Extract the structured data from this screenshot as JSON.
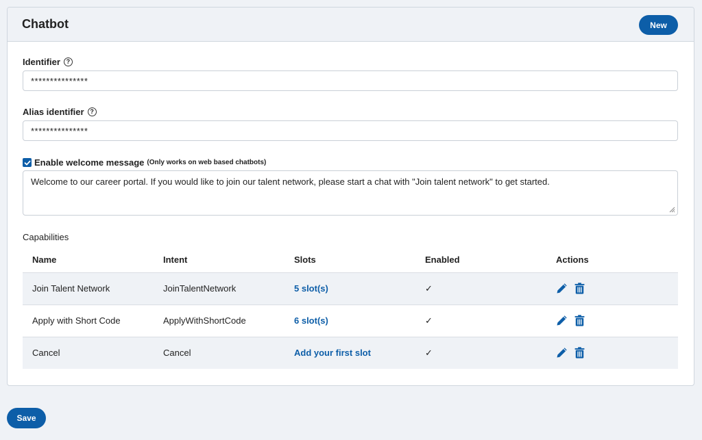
{
  "header": {
    "title": "Chatbot",
    "new_label": "New"
  },
  "identifier": {
    "label": "Identifier",
    "value": "***************"
  },
  "alias": {
    "label": "Alias identifier",
    "value": "***************"
  },
  "welcome": {
    "enabled": true,
    "label": "Enable welcome message",
    "note": "(Only works on web based chatbots)",
    "message": "Welcome to our career portal. If you would like to join our talent network, please start a chat with \"Join talent network\" to get started."
  },
  "capabilities": {
    "title": "Capabilities",
    "columns": [
      "Name",
      "Intent",
      "Slots",
      "Enabled",
      "Actions"
    ],
    "rows": [
      {
        "name": "Join Talent Network",
        "intent": "JoinTalentNetwork",
        "slots": "5 slot(s)",
        "enabled": "✓"
      },
      {
        "name": "Apply with Short Code",
        "intent": "ApplyWithShortCode",
        "slots": "6 slot(s)",
        "enabled": "✓"
      },
      {
        "name": "Cancel",
        "intent": "Cancel",
        "slots": "Add your first slot",
        "enabled": "✓"
      }
    ]
  },
  "footer": {
    "save_label": "Save"
  },
  "colors": {
    "primary": "#0d5ea8",
    "background": "#eff2f6",
    "stripe": "#eff2f6"
  },
  "icons": {
    "help": "help-circle-icon",
    "edit": "pencil-icon",
    "delete": "trash-icon",
    "checkbox": "checkbox-checked-icon"
  }
}
